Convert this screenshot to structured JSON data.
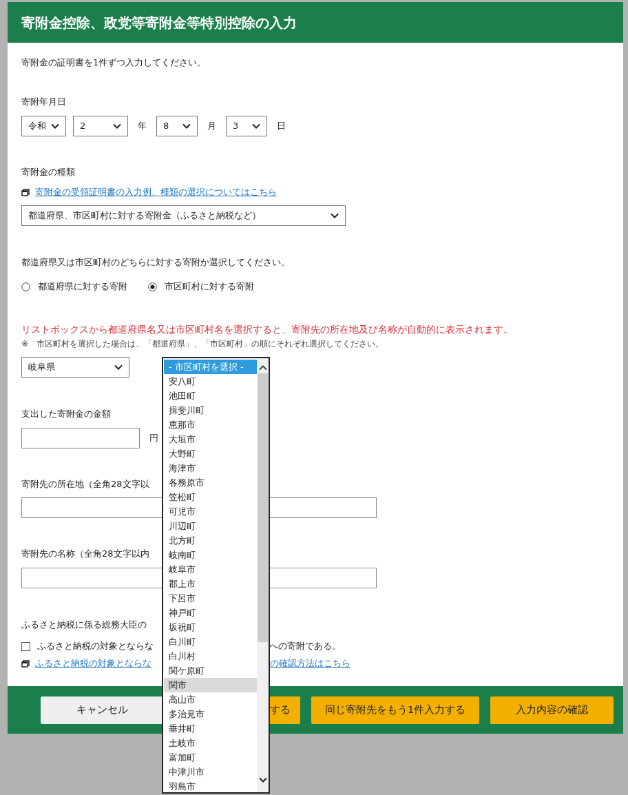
{
  "title": "寄附金控除、政党等寄附金等特別控除の入力",
  "intro": "寄附金の証明書を1件ずつ入力してください。",
  "date": {
    "label": "寄附年月日",
    "fields": [
      {
        "value": "令和"
      },
      {
        "value": "2",
        "unit": "年"
      },
      {
        "value": "8",
        "unit": "月"
      },
      {
        "value": "3",
        "unit": "日"
      }
    ]
  },
  "donation_type": {
    "label": "寄附金の種類",
    "link": "寄附金の受領証明書の入力例、種類の選択についてはこちら",
    "value": "都道府県、市区町村に対する寄附金（ふるさと納税など）"
  },
  "target": {
    "question": "都道府県又は市区町村のどちらに対する寄附か選択してください。",
    "options": [
      {
        "label": "都道府県に対する寄附",
        "selected": false
      },
      {
        "label": "市区町村に対する寄附",
        "selected": true
      }
    ]
  },
  "notice": {
    "warning": "リストボックスから都道府県名又は市区町村名を選択すると、寄附先の所在地及び名称が自動的に表示されます。",
    "note": "※　市区町村を選択した場合は、「都道府県」、「市区町村」の順にそれぞれ選択してください。"
  },
  "prefecture": {
    "value": "岐阜県"
  },
  "city_list": {
    "items": [
      {
        "label": "- 市区町村を選択 -",
        "selected": true,
        "hovered": false
      },
      {
        "label": "安八町",
        "selected": false,
        "hovered": false
      },
      {
        "label": "池田町",
        "selected": false,
        "hovered": false
      },
      {
        "label": "揖斐川町",
        "selected": false,
        "hovered": false
      },
      {
        "label": "恵那市",
        "selected": false,
        "hovered": false
      },
      {
        "label": "大垣市",
        "selected": false,
        "hovered": false
      },
      {
        "label": "大野町",
        "selected": false,
        "hovered": false
      },
      {
        "label": "海津市",
        "selected": false,
        "hovered": false
      },
      {
        "label": "各務原市",
        "selected": false,
        "hovered": false
      },
      {
        "label": "笠松町",
        "selected": false,
        "hovered": false
      },
      {
        "label": "可児市",
        "selected": false,
        "hovered": false
      },
      {
        "label": "川辺町",
        "selected": false,
        "hovered": false
      },
      {
        "label": "北方町",
        "selected": false,
        "hovered": false
      },
      {
        "label": "岐南町",
        "selected": false,
        "hovered": false
      },
      {
        "label": "岐阜市",
        "selected": false,
        "hovered": false
      },
      {
        "label": "郡上市",
        "selected": false,
        "hovered": false
      },
      {
        "label": "下呂市",
        "selected": false,
        "hovered": false
      },
      {
        "label": "神戸町",
        "selected": false,
        "hovered": false
      },
      {
        "label": "坂祝町",
        "selected": false,
        "hovered": false
      },
      {
        "label": "白川町",
        "selected": false,
        "hovered": false
      },
      {
        "label": "白川村",
        "selected": false,
        "hovered": false
      },
      {
        "label": "関ケ原町",
        "selected": false,
        "hovered": false
      },
      {
        "label": "関市",
        "selected": false,
        "hovered": true
      },
      {
        "label": "高山市",
        "selected": false,
        "hovered": false
      },
      {
        "label": "多治見市",
        "selected": false,
        "hovered": false
      },
      {
        "label": "垂井町",
        "selected": false,
        "hovered": false
      },
      {
        "label": "土岐市",
        "selected": false,
        "hovered": false
      },
      {
        "label": "富加町",
        "selected": false,
        "hovered": false
      },
      {
        "label": "中津川市",
        "selected": false,
        "hovered": false
      },
      {
        "label": "羽島市",
        "selected": false,
        "hovered": false
      }
    ]
  },
  "amount": {
    "label": "支出した寄附金の金額",
    "unit": "円"
  },
  "address": {
    "label": "寄附先の所在地（全角28文字以"
  },
  "recipient_name": {
    "label": "寄附先の名称（全角28文字以内"
  },
  "furusato": {
    "label": "ふるさと納税に係る総務大臣の",
    "checkbox": {
      "checked": false,
      "text_start": "ふるさと納税の対象とならな",
      "text_end": "への寄附である。"
    },
    "link_start": "ふるさと納税の対象とならな",
    "link_end": "の確認方法はこちら"
  },
  "buttons": [
    {
      "label": "キャンセル",
      "kind": "secondary"
    },
    {
      "label": "する",
      "kind": "primary"
    },
    {
      "label": "同じ寄附先をもう1件入力する",
      "kind": "primary"
    },
    {
      "label": "入力内容の確認",
      "kind": "primary"
    }
  ]
}
